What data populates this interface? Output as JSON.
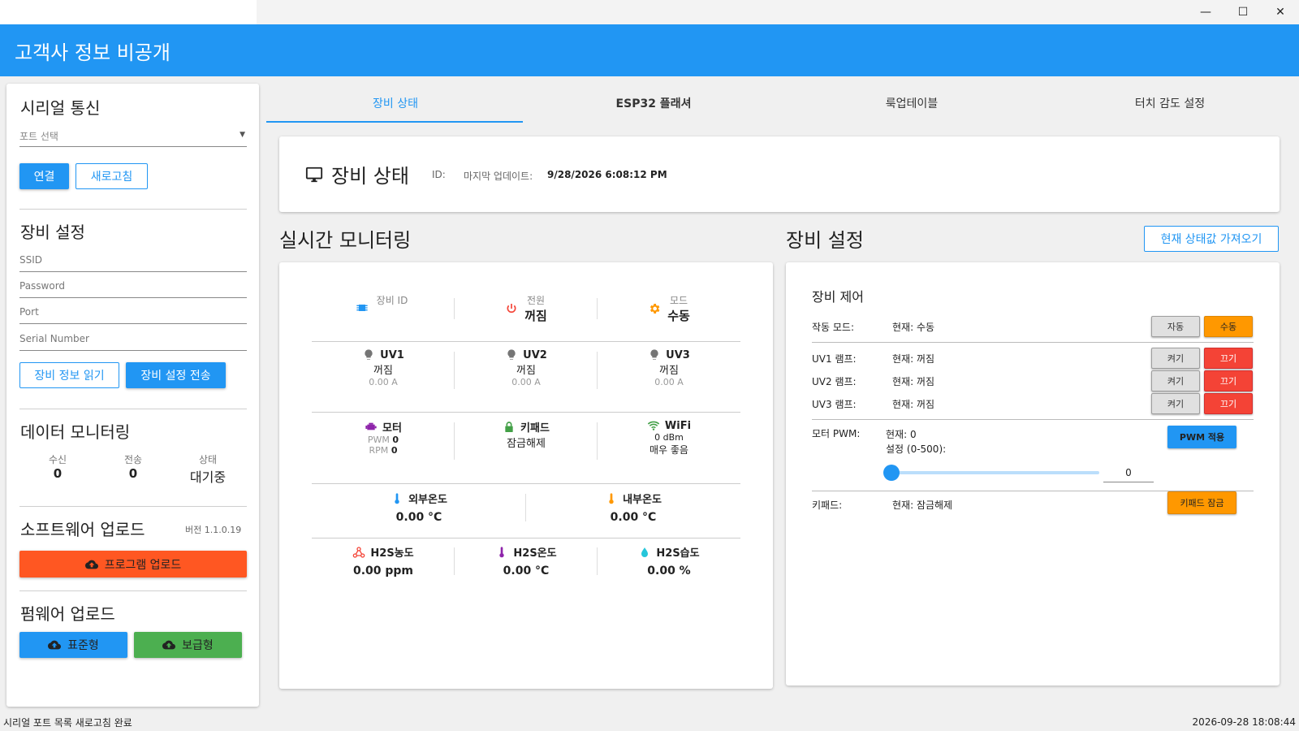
{
  "window": {
    "minimize": "—",
    "maximize": "☐",
    "close": "✕"
  },
  "app": {
    "title": "고객사 정보 비공개"
  },
  "sidebar": {
    "serial": {
      "title": "시리얼 통신",
      "port_placeholder": "포트 선택",
      "connect": "연결",
      "refresh": "새로고침"
    },
    "device_settings": {
      "title": "장비 설정",
      "ssid": "SSID",
      "password": "Password",
      "port": "Port",
      "serial_number": "Serial Number",
      "read_btn": "장비 정보 읽기",
      "send_btn": "장비 설정 전송"
    },
    "data_monitor": {
      "title": "데이터 모니터링",
      "rx_label": "수신",
      "rx_value": "0",
      "tx_label": "전송",
      "tx_value": "0",
      "state_label": "상태",
      "state_value": "대기중"
    },
    "software": {
      "title": "소프트웨어 업로드",
      "version": "버전 1.1.0.19",
      "upload_btn": "프로그램 업로드"
    },
    "firmware": {
      "title": "펌웨어 업로드",
      "standard_btn": "표준형",
      "basic_btn": "보급형"
    }
  },
  "tabs": [
    "장비 상태",
    "ESP32 플래셔",
    "룩업테이블",
    "터치 감도 설정"
  ],
  "active_tab": 0,
  "status_header": {
    "title": "장비 상태",
    "id_label": "ID:",
    "id_value": "",
    "updated_label": "마지막 업데이트:",
    "updated_value": "9/28/2026 6:08:12 PM"
  },
  "monitoring": {
    "title": "실시간 모니터링",
    "device_id_label": "장비 ID",
    "power_label": "전원",
    "power_value": "꺼짐",
    "mode_label": "모드",
    "mode_value": "수동",
    "uv": [
      {
        "name": "UV1",
        "state": "꺼짐",
        "current": "0.00 A"
      },
      {
        "name": "UV2",
        "state": "꺼짐",
        "current": "0.00 A"
      },
      {
        "name": "UV3",
        "state": "꺼짐",
        "current": "0.00 A"
      }
    ],
    "motor": {
      "name": "모터",
      "pwm_label": "PWM",
      "pwm_value": "0",
      "rpm_label": "RPM",
      "rpm_value": "0"
    },
    "keypad": {
      "name": "키패드",
      "state": "잠금해제"
    },
    "wifi": {
      "name": "WiFi",
      "signal": "0 dBm",
      "quality": "매우 좋음"
    },
    "temps": [
      {
        "name": "외부온도",
        "value": "0.00 °C"
      },
      {
        "name": "내부온도",
        "value": "0.00 °C"
      }
    ],
    "h2s": [
      {
        "name": "H2S농도",
        "value": "0.00 ppm"
      },
      {
        "name": "H2S온도",
        "value": "0.00 °C"
      },
      {
        "name": "H2S습도",
        "value": "0.00 %"
      }
    ]
  },
  "settings": {
    "title": "장비 설정",
    "fetch_btn": "현재 상태값 가져오기",
    "control_title": "장비 제어",
    "mode": {
      "label": "작동 모드:",
      "current": "현재: 수동",
      "auto": "자동",
      "manual": "수동"
    },
    "lamps": [
      {
        "label": "UV1 램프:",
        "current": "현재: 꺼짐",
        "on": "켜기",
        "off": "끄기"
      },
      {
        "label": "UV2 램프:",
        "current": "현재: 꺼짐",
        "on": "켜기",
        "off": "끄기"
      },
      {
        "label": "UV3 램프:",
        "current": "현재: 꺼짐",
        "on": "켜기",
        "off": "끄기"
      }
    ],
    "pwm": {
      "label": "모터 PWM:",
      "current": "현재: 0",
      "setting_label": "설정 (0-500):",
      "apply": "PWM 적용",
      "value": "0",
      "slider_fraction": 0
    },
    "keypad": {
      "label": "키패드:",
      "current": "현재: 잠금해제",
      "lock": "키패드 잠금"
    }
  },
  "status_bar": {
    "message": "시리얼 포트 목록 새로고침 완료",
    "timestamp": "2026-09-28 18:08:44"
  },
  "colors": {
    "primary": "#2196f3",
    "orange": "#ff9800",
    "red": "#f44336",
    "green": "#4caf50",
    "deep_orange": "#ff5722"
  }
}
